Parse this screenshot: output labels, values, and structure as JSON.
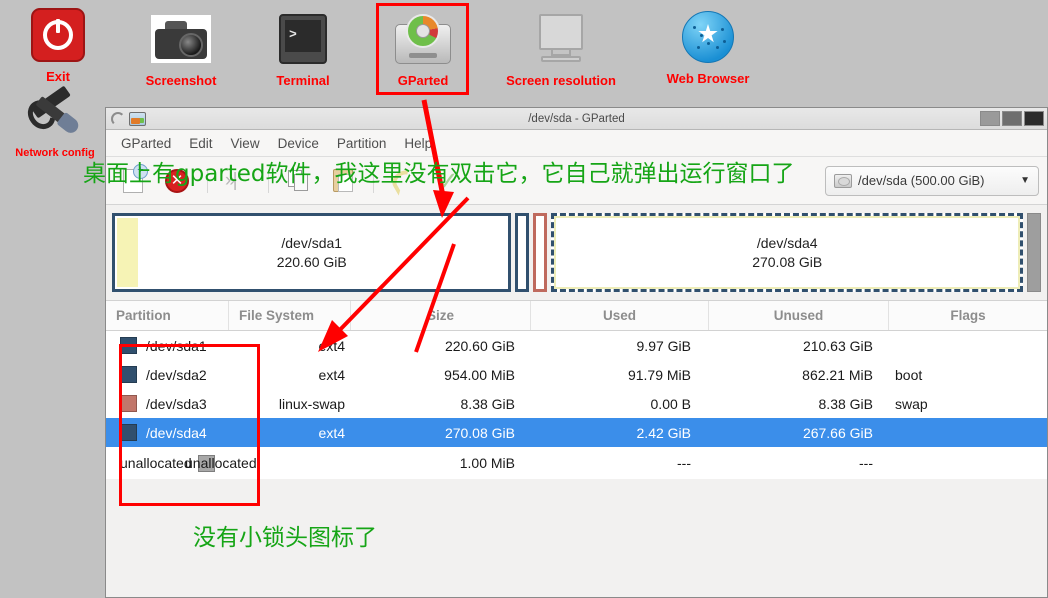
{
  "desktop": {
    "icons": [
      {
        "label": "Exit",
        "icon": "power-icon"
      },
      {
        "label": "Screenshot",
        "icon": "camera-icon"
      },
      {
        "label": "Terminal",
        "icon": "terminal-icon"
      },
      {
        "label": "GParted",
        "icon": "disk-icon"
      },
      {
        "label": "Screen resolution",
        "icon": "monitor-icon"
      },
      {
        "label": "Web Browser",
        "icon": "globe-icon"
      },
      {
        "label": "Network config",
        "icon": "wrench-screwdriver-icon"
      }
    ]
  },
  "window": {
    "title": "/dev/sda - GParted",
    "controls": {
      "minimize": "–",
      "maximize": "□",
      "close": "✕"
    },
    "menus": [
      "GParted",
      "Edit",
      "View",
      "Device",
      "Partition",
      "Help"
    ],
    "toolbar": {
      "buttons": [
        "new-partition-icon",
        "delete-partition-icon",
        "resize-move-icon",
        "copy-icon",
        "paste-icon",
        "undo-icon",
        "apply-icon"
      ]
    },
    "device_selector": {
      "value": "/dev/sda (500.00 GiB)",
      "arrow": "▼"
    }
  },
  "graphic": {
    "partitions": [
      {
        "name": "/dev/sda1",
        "size": "220.60 GiB",
        "kind": "big",
        "border": "#31506e",
        "used_color": "#f6f3b5",
        "used_pct": 4.5,
        "flex": 404,
        "selected": false
      },
      {
        "name": "/dev/sda2",
        "size": "954.00 MiB",
        "kind": "mini",
        "border": "#31506e",
        "selected": false
      },
      {
        "name": "/dev/sda3",
        "size": "8.38 GiB",
        "kind": "mini",
        "border": "#bf6a5e",
        "selected": false
      },
      {
        "name": "/dev/sda4",
        "size": "270.08 GiB",
        "kind": "big",
        "border": "#31506e",
        "used_color": "#f6f3b5",
        "used_pct": 0.9,
        "flex": 478,
        "selected": true
      },
      {
        "name": "unallocated",
        "size": "1.00 MiB",
        "kind": "end",
        "border": "#8a8a8a",
        "selected": false
      }
    ]
  },
  "table": {
    "columns": [
      "Partition",
      "File System",
      "Size",
      "Used",
      "Unused",
      "Flags"
    ],
    "rows": [
      {
        "partition": "/dev/sda1",
        "swatch": "#31506e",
        "filesystem": "ext4",
        "size": "220.60 GiB",
        "used": "9.97 GiB",
        "unused": "210.63 GiB",
        "flags": "",
        "selected": false
      },
      {
        "partition": "/dev/sda2",
        "swatch": "#31506e",
        "filesystem": "ext4",
        "size": "954.00 MiB",
        "used": "91.79 MiB",
        "unused": "862.21 MiB",
        "flags": "boot",
        "selected": false
      },
      {
        "partition": "/dev/sda3",
        "swatch": "#c1766a",
        "filesystem": "linux-swap",
        "size": "8.38 GiB",
        "used": "0.00 B",
        "unused": "8.38 GiB",
        "flags": "swap",
        "selected": false
      },
      {
        "partition": "/dev/sda4",
        "swatch": "#31506e",
        "filesystem": "ext4",
        "size": "270.08 GiB",
        "used": "2.42 GiB",
        "unused": "267.66 GiB",
        "flags": "",
        "selected": true
      },
      {
        "partition": "unallocated",
        "swatch": "#a8a8a8",
        "filesystem": "unallocated",
        "size": "1.00 MiB",
        "used": "---",
        "unused": "---",
        "flags": "",
        "selected": false
      }
    ]
  },
  "annotations": {
    "top": "桌面上有gparted软件，我这里没有双击它，它自己就弹出运行窗口了",
    "bottom": "没有小锁头图标了",
    "color": "#16a516",
    "highlight_color": "#ff0000"
  }
}
